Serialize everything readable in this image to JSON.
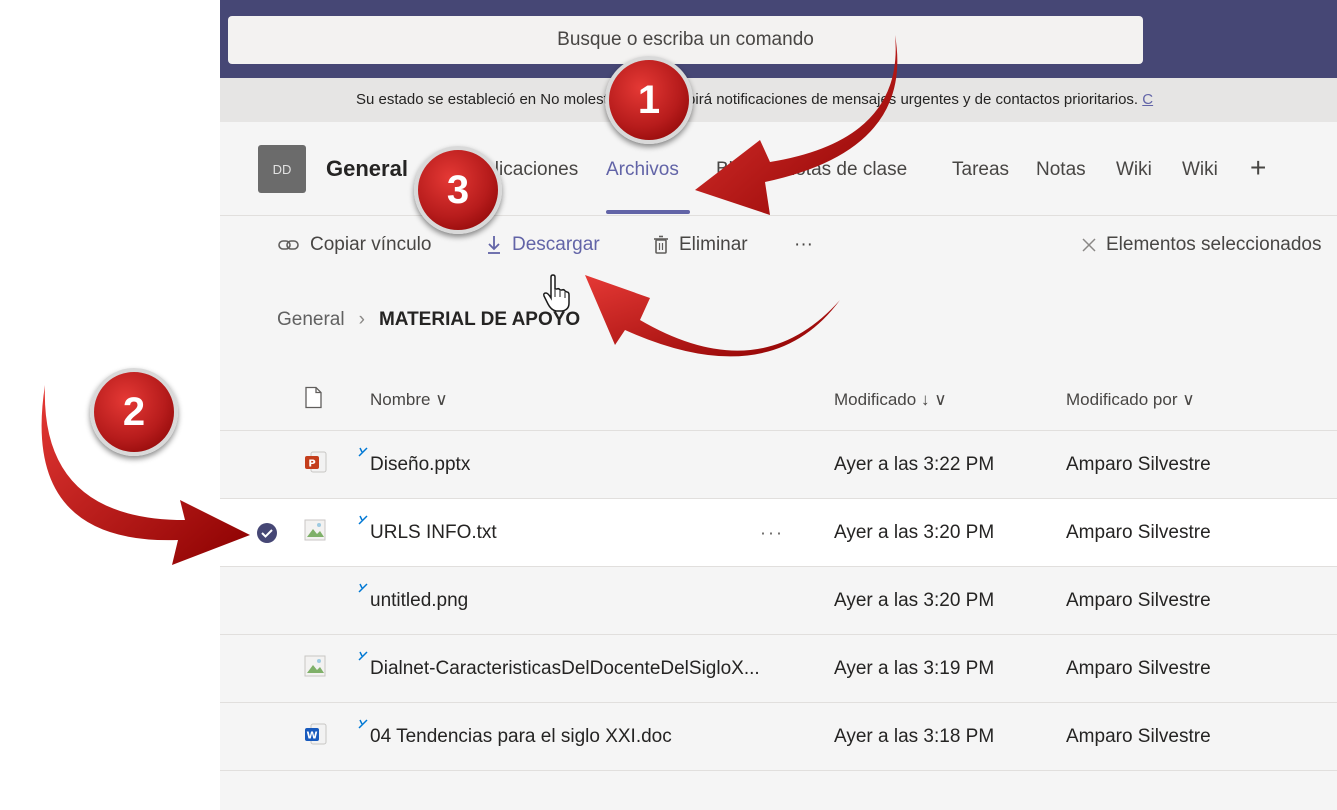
{
  "search": {
    "placeholder": "Busque o escriba un comando"
  },
  "notice": {
    "text": "Su estado se estableció en No molestar. Solo recibirá notificaciones de mensajes urgentes y de contactos prioritarios.",
    "link": "C"
  },
  "channel": {
    "avatar": "DD",
    "name": "General",
    "tabs": [
      {
        "label": "Publicaciones"
      },
      {
        "label": "Archivos",
        "active": true
      },
      {
        "label": "Bloc de notas de clase"
      },
      {
        "label": "Tareas"
      },
      {
        "label": "Notas"
      },
      {
        "label": "Wiki"
      },
      {
        "label": "Wiki"
      }
    ],
    "add_tab": "+"
  },
  "toolbar": {
    "copy_link": "Copiar vínculo",
    "download": "Descargar",
    "delete": "Eliminar",
    "more": "···",
    "selected": "Elementos seleccionados"
  },
  "breadcrumb": {
    "root": "General",
    "current": "MATERIAL DE APOYO"
  },
  "files": {
    "columns": {
      "name": "Nombre",
      "modified": "Modificado",
      "modified_by": "Modificado por"
    },
    "rows": [
      {
        "name": "Diseño.pptx",
        "modified": "Ayer a las 3:22 PM",
        "by": "Amparo Silvestre",
        "icon": "powerpoint-icon",
        "selected": false
      },
      {
        "name": "URLS INFO.txt",
        "modified": "Ayer a las 3:20 PM",
        "by": "Amparo Silvestre",
        "icon": "broken-image-icon",
        "selected": true
      },
      {
        "name": "untitled.png",
        "modified": "Ayer a las 3:20 PM",
        "by": "Amparo Silvestre",
        "icon": "none",
        "selected": false
      },
      {
        "name": "Dialnet-CaracteristicasDelDocenteDelSigloX...",
        "modified": "Ayer a las 3:19 PM",
        "by": "Amparo Silvestre",
        "icon": "broken-image-icon",
        "selected": false
      },
      {
        "name": "04 Tendencias para el siglo XXI.doc",
        "modified": "Ayer a las 3:18 PM",
        "by": "Amparo Silvestre",
        "icon": "word-icon",
        "selected": false
      }
    ],
    "row_more": "···"
  },
  "annotations": {
    "badge1": "1",
    "badge2": "2",
    "badge3": "3"
  },
  "colors": {
    "accent": "#6264a7",
    "topbar": "#464775",
    "annotation_red": "#c62828"
  }
}
